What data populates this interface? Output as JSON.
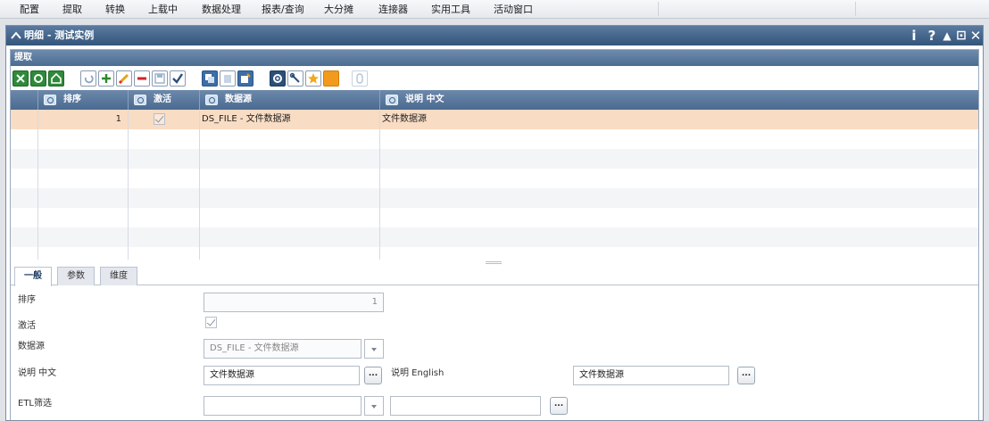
{
  "menu": {
    "items": [
      "配置",
      "提取",
      "转换",
      "上载中",
      "数据处理",
      "报表/查询",
      "大分摊",
      "连接器",
      "实用工具",
      "活动窗口"
    ]
  },
  "window": {
    "title": "明细 - 测试实例",
    "controls": {
      "info": "i",
      "help": "?",
      "collapse": "▲",
      "maximize": "⊡",
      "close": "✕"
    }
  },
  "panel": {
    "title": "提取"
  },
  "grid": {
    "columns": [
      "排序",
      "激活",
      "数据源",
      "说明 中文"
    ],
    "rows": [
      {
        "order": "1",
        "active": true,
        "source": "DS_FILE - 文件数据源",
        "desc": "文件数据源"
      }
    ]
  },
  "tabs": [
    "一般",
    "参数",
    "维度"
  ],
  "form": {
    "order_label": "排序",
    "order_value": "1",
    "active_label": "激活",
    "source_label": "数据源",
    "source_value": "DS_FILE - 文件数据源",
    "desc_cn_label": "说明 中文",
    "desc_cn_value": "文件数据源",
    "desc_en_label": "说明 English",
    "desc_en_value": "文件数据源",
    "etl_label": "ETL筛选",
    "etl_value": "",
    "etl_text": "",
    "ellipsis": "..."
  },
  "colors": {
    "header_blue": "#4b6a90",
    "selected_row": "#f9dcc4"
  }
}
